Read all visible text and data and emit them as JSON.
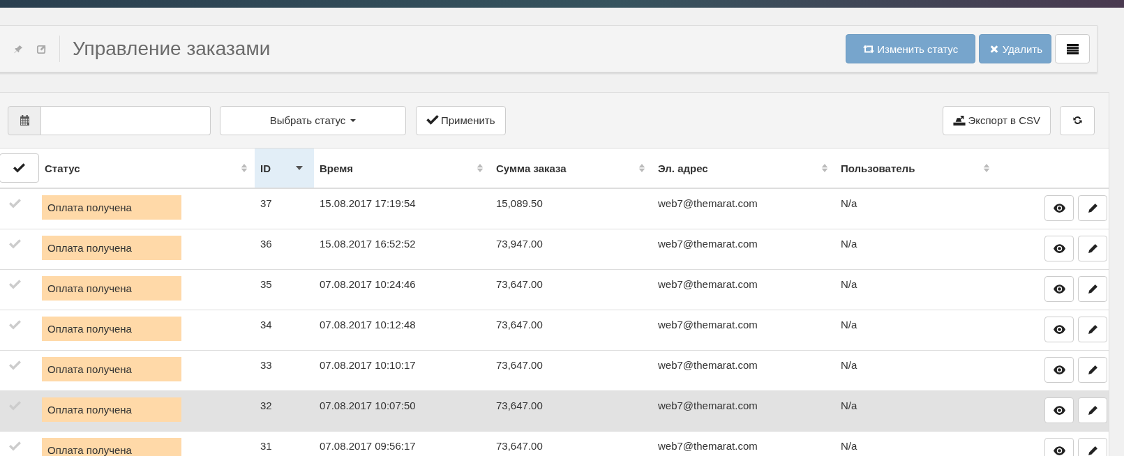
{
  "header": {
    "title": "Управление заказами",
    "buttons": [
      {
        "label": "Изменить статус",
        "kind": "status"
      },
      {
        "label": "Удалить",
        "kind": "delete"
      }
    ]
  },
  "filters": {
    "status_button": "Выбрать статус",
    "apply_button": "Применить",
    "export_button": "Экспорт в CSV"
  },
  "table": {
    "select_all": {
      "checked": false
    },
    "columns": [
      {
        "label": "Статус",
        "sorted": false
      },
      {
        "label": "ID",
        "sorted": true
      },
      {
        "label": "Время",
        "sorted": false
      },
      {
        "label": "Сумма заказа",
        "sorted": false
      },
      {
        "label": "Эл. адрес",
        "sorted": false
      },
      {
        "label": "Пользователь",
        "sorted": false
      }
    ],
    "rows": [
      {
        "status": "Оплата получена",
        "id": "37",
        "time": "15.08.2017 17:19:54",
        "amount": "15,089.50",
        "email": "web7@themarat.com",
        "user": "N/a",
        "highlighted": false
      },
      {
        "status": "Оплата получена",
        "id": "36",
        "time": "15.08.2017 16:52:52",
        "amount": "73,947.00",
        "email": "web7@themarat.com",
        "user": "N/a",
        "highlighted": false
      },
      {
        "status": "Оплата получена",
        "id": "35",
        "time": "07.08.2017 10:24:46",
        "amount": "73,647.00",
        "email": "web7@themarat.com",
        "user": "N/a",
        "highlighted": false
      },
      {
        "status": "Оплата получена",
        "id": "34",
        "time": "07.08.2017 10:12:48",
        "amount": "73,647.00",
        "email": "web7@themarat.com",
        "user": "N/a",
        "highlighted": false
      },
      {
        "status": "Оплата получена",
        "id": "33",
        "time": "07.08.2017 10:10:17",
        "amount": "73,647.00",
        "email": "web7@themarat.com",
        "user": "N/a",
        "highlighted": false
      },
      {
        "status": "Оплата получена",
        "id": "32",
        "time": "07.08.2017 10:07:50",
        "amount": "73,647.00",
        "email": "web7@themarat.com",
        "user": "N/a",
        "highlighted": true
      },
      {
        "status": "Оплата получена",
        "id": "31",
        "time": "07.08.2017 09:56:17",
        "amount": "73,647.00",
        "email": "web7@themarat.com",
        "user": "N/a",
        "highlighted": false
      }
    ]
  }
}
